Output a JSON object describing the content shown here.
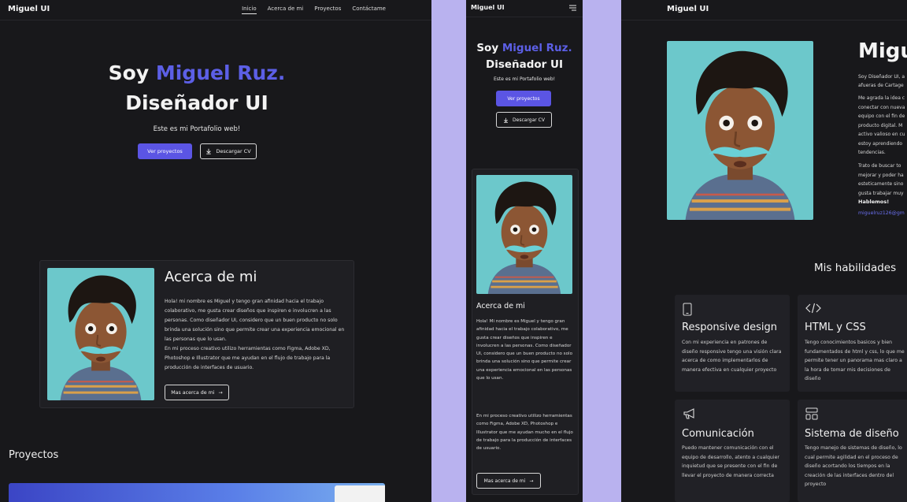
{
  "colors": {
    "accent": "#5b55e4",
    "background": "#18181b",
    "card": "#1f1f23",
    "separator": "#b9b2ef"
  },
  "desktop": {
    "brand": "Miguel UI",
    "nav": [
      "Inicio",
      "Acerca de mi",
      "Proyectos",
      "Contáctame"
    ],
    "hero": {
      "title_prefix": "Soy",
      "title_name": "Miguel Ruz.",
      "title_line2": "Diseñador UI",
      "subtitle": "Este es mi Portafolio web!",
      "btn_projects": "Ver proyectos",
      "btn_cv": "Descargar CV"
    },
    "about": {
      "title": "Acerca de mi",
      "p1": "Hola! mi nombre es Miguel y tengo gran afinidad hacia el trabajo colaborativo, me gusta crear diseños que inspiren e involucren a las personas. Como diseñador UI, considero que un buen producto no solo brinda una solución sino que permite crear una experiencia emocional en las personas que lo usan.",
      "p2": "En mi proceso creativo utilizo herramientas como Figma, Adobe XD, Photoshop e Illustrator que me ayudan en el flujo de trabajo para la producción de interfaces de usuario.",
      "more": "Mas acerca de mi"
    },
    "projects_title": "Proyectos"
  },
  "mobile": {
    "brand": "Miguel UI",
    "hero": {
      "title_prefix": "Soy",
      "title_name": "Miguel Ruz.",
      "title_line2": "Diseñador UI",
      "subtitle": "Este es mi Portafolio web!",
      "btn_projects": "Ver proyectos",
      "btn_cv": "Descargar CV"
    },
    "about": {
      "title": "Acerca de mi",
      "p1": "Hola! Mi nombre es Miguel y tengo gran afinidad hacia el trabajo colaborativo, me gusta crear diseños que inspiren e involucren a las personas. Como diseñador UI, considero que un buen producto no solo brinda una solución sino que permite crear una experiencia emocional en las personas que lo usan.",
      "p2": "En mi proceso creativo utilizo herramientas como Figma, Adobe XD, Photoshop e Illustrator que me ayudan mucho en el flujo de trabajo para la producción de interfaces de usuario.",
      "more": "Mas acerca de mi"
    }
  },
  "about_page": {
    "brand": "Miguel UI",
    "name_partial": "Migue",
    "intro": "Soy Diseñador UI, a afueras de Cartage",
    "p_lines": [
      "Me agrada la idea c",
      "conectar con nueva",
      "equipo con el fin de",
      "producto digital. M",
      "activo valioso en cu",
      "estoy aprendiendo",
      "tendencias."
    ],
    "p2_lines": [
      "Trato de buscar to",
      "mejorar y poder ha",
      "esteticamente sino",
      "gusta trabajar muy"
    ],
    "cta": "Hablemos!",
    "email": "miguelruz126@gm",
    "skills_title": "Mis habilidades",
    "skills": [
      {
        "icon": "mobile-icon",
        "title": "Responsive design",
        "text": "Con mi experiencia en patrones de diseño responsive tengo una visión clara acerca de como implementarlos de manera efectiva en cualquier proyecto"
      },
      {
        "icon": "code-icon",
        "title": "HTML y CSS",
        "text": "Tengo conocimientos basicos y bien fundamentados de html y css, lo que me permite tener un panorama mas claro a la hora de tomar mis decisiones de diseño"
      },
      {
        "icon": "megaphone-icon",
        "title": "Comunicación",
        "text": "Puedo mantener comunicación  con el equipo de desarrollo, atento a cualquier inquietud que se presente con el fin de llevar el proyecto de manera correcta"
      },
      {
        "icon": "layout-icon",
        "title": "Sistema de diseño",
        "text": "Tengo manejo de sistemas de diseño, lo cual permite agilidad en el proceso de diseño acortando los tiempos en la creación de las interfaces dentro del proyecto"
      }
    ]
  }
}
